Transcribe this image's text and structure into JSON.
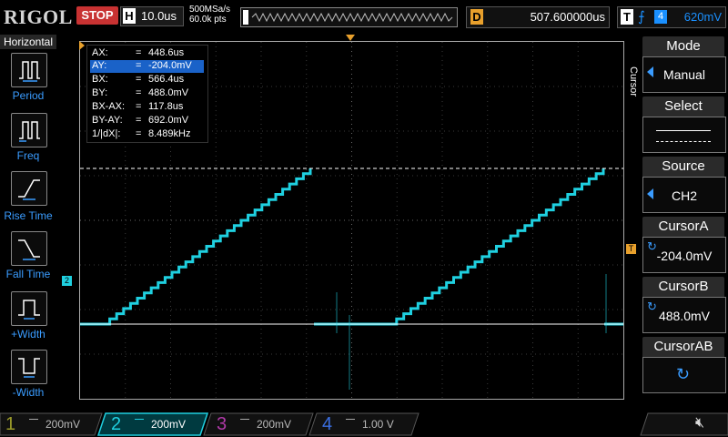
{
  "top": {
    "brand": "RIGOL",
    "run_state": "STOP",
    "h_label": "H",
    "timebase": "10.0us",
    "sample_rate": "500MSa/s",
    "memory_depth": "60.0k pts",
    "d_label": "D",
    "delay": "507.600000us",
    "t_label": "T",
    "trigger_source": "4",
    "trigger_level": "620mV"
  },
  "left_panel": {
    "title": "Horizontal",
    "items": [
      {
        "label": "Period"
      },
      {
        "label": "Freq"
      },
      {
        "label": "Rise Time"
      },
      {
        "label": "Fall Time"
      },
      {
        "label": "+Width"
      },
      {
        "label": "-Width"
      }
    ]
  },
  "cursor_readout": [
    {
      "key": "AX:",
      "value": "448.6us"
    },
    {
      "key": "AY:",
      "value": "-204.0mV"
    },
    {
      "key": "BX:",
      "value": "566.4us"
    },
    {
      "key": "BY:",
      "value": "488.0mV"
    },
    {
      "key": "BX-AX:",
      "value": "117.8us"
    },
    {
      "key": "BY-AY:",
      "value": "692.0mV"
    },
    {
      "key": "1/|dX|:",
      "value": "8.489kHz"
    }
  ],
  "channel_marker": "2",
  "trigger_marker": "T",
  "menu": {
    "side_title": "Cursor",
    "mode_label": "Mode",
    "mode_value": "Manual",
    "select_label": "Select",
    "source_label": "Source",
    "source_value": "CH2",
    "cursor_a_label": "CursorA",
    "cursor_a_value": "-204.0mV",
    "cursor_b_label": "CursorB",
    "cursor_b_value": "488.0mV",
    "cursor_ab_label": "CursorAB"
  },
  "channels": [
    {
      "num": "1",
      "scale": "200mV",
      "color": "#9a9a2a"
    },
    {
      "num": "2",
      "scale": "200mV",
      "color": "#1fd0e0"
    },
    {
      "num": "3",
      "scale": "200mV",
      "color": "#b03aa8"
    },
    {
      "num": "4",
      "scale": "1.00 V",
      "color": "#3a6ee0"
    }
  ],
  "colors": {
    "trace": "#1fd0e0",
    "accent": "#3a9cff",
    "trigger": "#e8a02c",
    "stop": "#c83232"
  },
  "icons": {
    "speaker": "speaker-mute-icon",
    "cursor_ab": "rotate-icon"
  }
}
